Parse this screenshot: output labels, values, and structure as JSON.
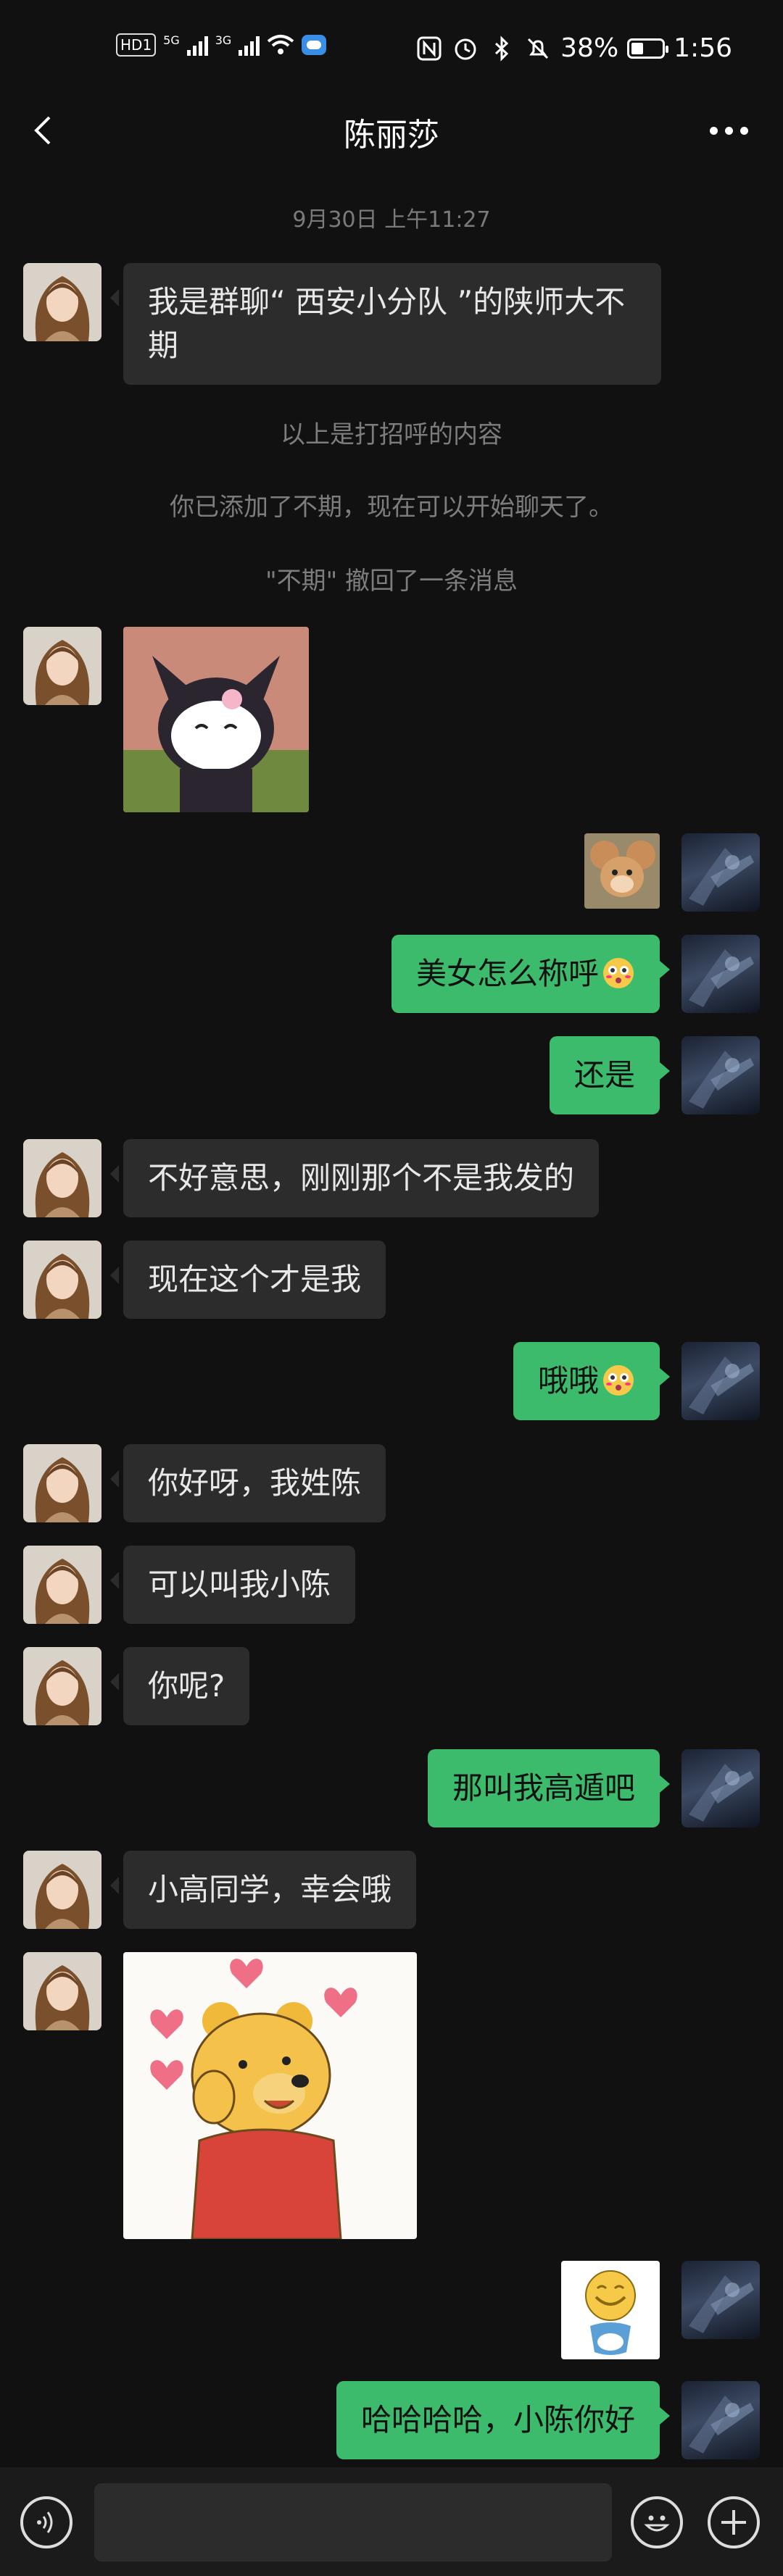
{
  "status_bar": {
    "hd": "HD1",
    "net1": "5G",
    "net2": "3G",
    "battery": "38%",
    "time": "1:56",
    "icons": [
      "nfc-icon",
      "alarm-icon",
      "bluetooth-icon",
      "mute-icon"
    ]
  },
  "header": {
    "title": "陈丽莎",
    "back_icon": "back-arrow-icon",
    "more_icon": "more-icon"
  },
  "chat": {
    "timestamp": "9月30日 上午11:27",
    "greeting": "我是群聊“ 西安小分队 ”的陕师大不期",
    "system_1": "以上是打招呼的内容",
    "system_2": "你已添加了不期，现在可以开始聊天了。",
    "system_3": "\"不期\" 撤回了一条消息",
    "sticker_1": "kuromi-sticker",
    "sticker_2": "jerry-mouse-sticker",
    "m1": "美女怎么称呼",
    "m2": "还是",
    "m3": "不好意思，刚刚那个不是我发的",
    "m4": "现在这个才是我",
    "m5": "哦哦",
    "m6": "你好呀，我姓陈",
    "m7": "可以叫我小陈",
    "m8": "你呢?",
    "m9": "那叫我高遁吧",
    "m10": "小高同学，幸会哦",
    "sticker_3": "winnie-the-pooh-sticker",
    "sticker_4": "smiley-face-sticker",
    "m11": "哈哈哈哈，小陈你好"
  },
  "colors": {
    "background": "#111111",
    "incoming": "#2c2c2c",
    "outgoing": "#3dbb6c"
  },
  "input_bar": {
    "voice_icon": "voice-icon",
    "emoji_icon": "emoji-icon",
    "add_icon": "plus-icon"
  }
}
